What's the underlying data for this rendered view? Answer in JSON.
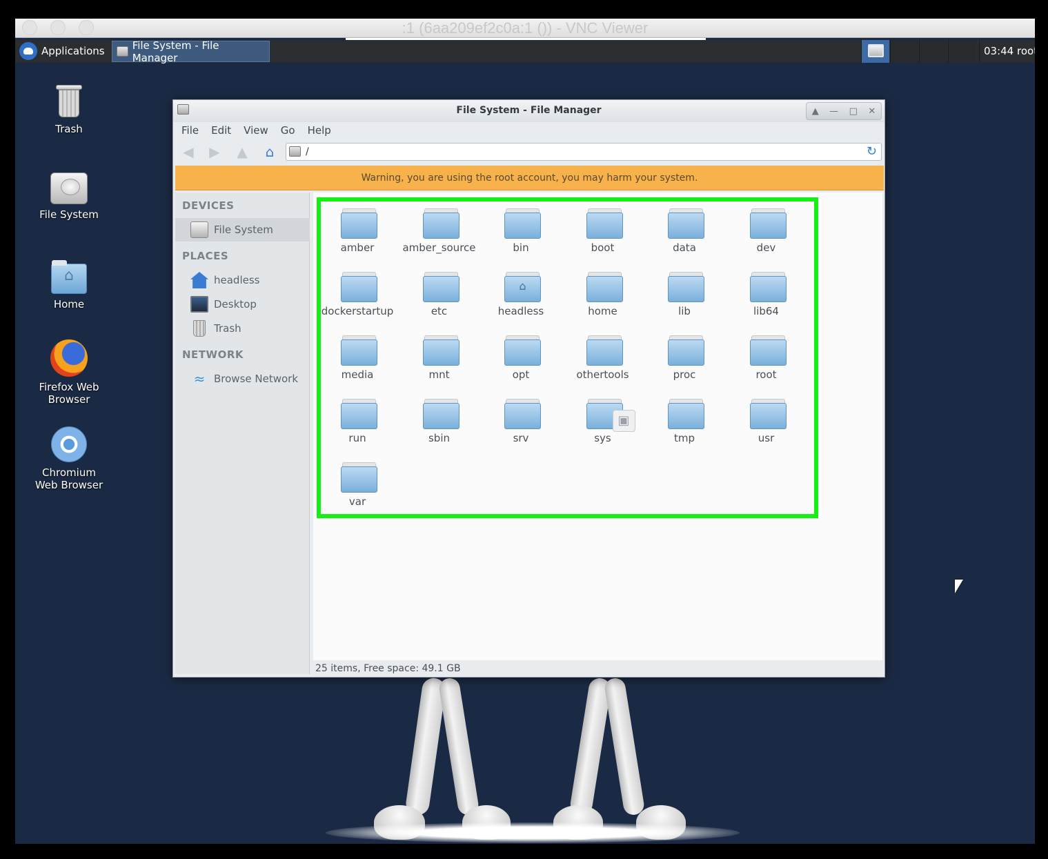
{
  "vnc": {
    "title": ":1 (6aa209ef2c0a:1 ()) - VNC Viewer"
  },
  "panel": {
    "applications_label": "Applications",
    "task_label": "File System - File Manager",
    "clock": "03:44",
    "user": "root"
  },
  "desktop_icons": [
    {
      "label": "Trash",
      "icon": "trash-icon"
    },
    {
      "label": "File System",
      "icon": "drive-icon"
    },
    {
      "label": "Home",
      "icon": "home-folder-icon"
    },
    {
      "label": "Firefox Web Browser",
      "icon": "firefox-icon"
    },
    {
      "label": "Chromium Web Browser",
      "icon": "chromium-icon"
    }
  ],
  "file_manager": {
    "title": "File System - File Manager",
    "menu": [
      "File",
      "Edit",
      "View",
      "Go",
      "Help"
    ],
    "location": "/",
    "warning": "Warning, you are using the root account, you may harm your system.",
    "sidebar": {
      "devices_heading": "DEVICES",
      "devices": [
        "File System"
      ],
      "places_heading": "PLACES",
      "places": [
        "headless",
        "Desktop",
        "Trash"
      ],
      "network_heading": "NETWORK",
      "network": [
        "Browse Network"
      ]
    },
    "folders": [
      {
        "name": "amber"
      },
      {
        "name": "amber_source"
      },
      {
        "name": "bin"
      },
      {
        "name": "boot"
      },
      {
        "name": "data"
      },
      {
        "name": "dev"
      },
      {
        "name": "dockerstartup"
      },
      {
        "name": "etc"
      },
      {
        "name": "headless",
        "emblem": "home"
      },
      {
        "name": "home"
      },
      {
        "name": "lib"
      },
      {
        "name": "lib64"
      },
      {
        "name": "media"
      },
      {
        "name": "mnt"
      },
      {
        "name": "opt"
      },
      {
        "name": "othertools"
      },
      {
        "name": "proc"
      },
      {
        "name": "root"
      },
      {
        "name": "run"
      },
      {
        "name": "sbin"
      },
      {
        "name": "srv"
      },
      {
        "name": "sys",
        "emblem": "lock"
      },
      {
        "name": "tmp"
      },
      {
        "name": "usr"
      },
      {
        "name": "var"
      }
    ],
    "status": "25 items, Free space: 49.1 GB"
  }
}
